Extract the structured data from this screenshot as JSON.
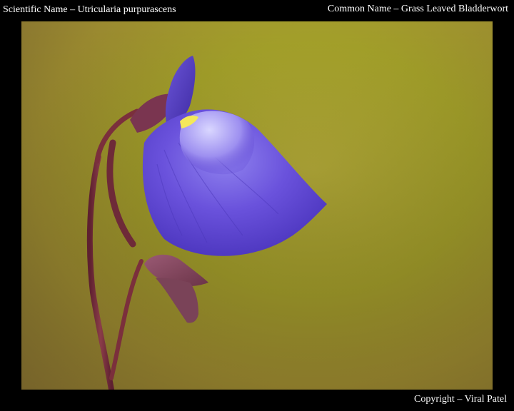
{
  "captions": {
    "scientific_name": "Scientific Name –  Utricularia purpurascens",
    "common_name": "Common Name – Grass Leaved Bladderwort",
    "copyright": "Copyright – Viral Patel"
  },
  "colors": {
    "frame_background": "#000000",
    "caption_text": "#ffffff",
    "background_olive": "#a5a22a",
    "background_brown": "#8f7a34",
    "petal_violet": "#5a3fd6",
    "petal_highlight": "#9d8ff0",
    "stem_maroon": "#7b2f3c",
    "bud_mauve": "#8a4a63",
    "throat_yellow": "#f4e85a"
  }
}
